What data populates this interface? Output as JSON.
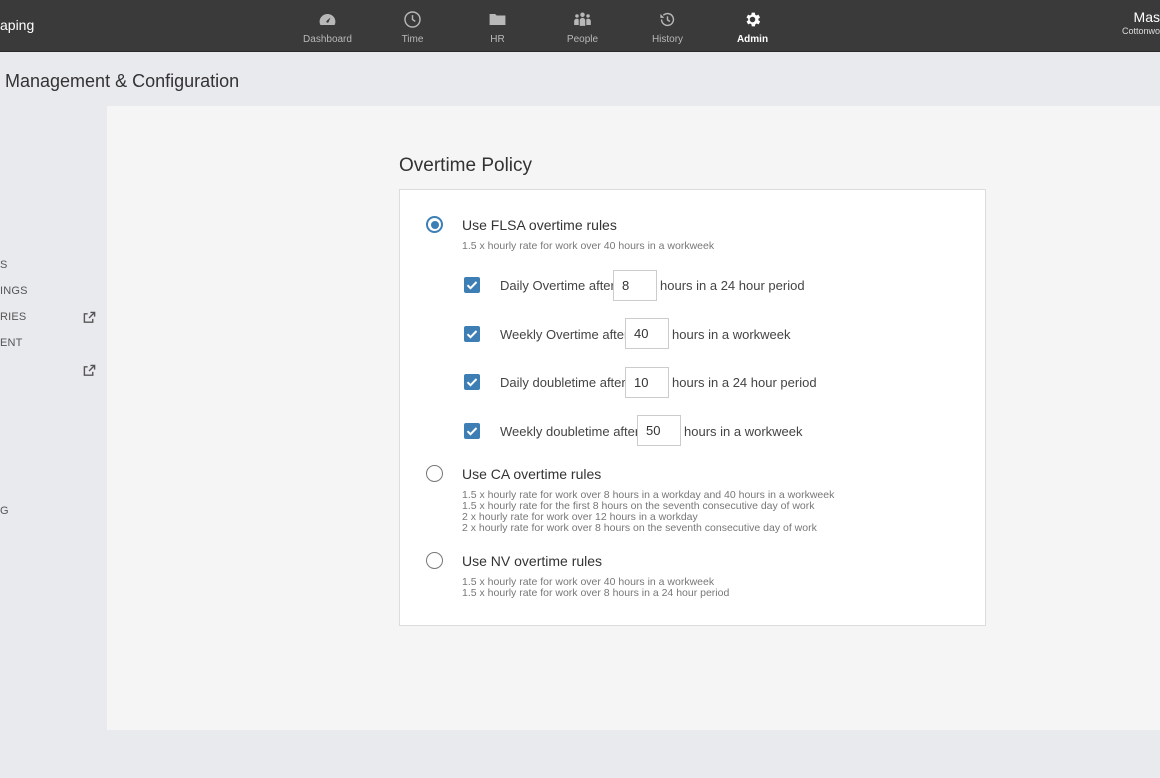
{
  "header": {
    "brand": "aping",
    "nav": [
      {
        "label": "Dashboard",
        "icon": "dashboard-icon"
      },
      {
        "label": "Time",
        "icon": "clock-icon"
      },
      {
        "label": "HR",
        "icon": "folder-icon"
      },
      {
        "label": "People",
        "icon": "people-icon"
      },
      {
        "label": "History",
        "icon": "history-icon"
      },
      {
        "label": "Admin",
        "icon": "gear-icon",
        "active": true
      }
    ],
    "user_name": "Mas",
    "user_org": "Cottonwo"
  },
  "page_title": "Management & Configuration",
  "sidebar": {
    "items": [
      {
        "label": "S"
      },
      {
        "label": "INGS"
      },
      {
        "label": "RIES",
        "external_icon": "external-link-icon"
      },
      {
        "label": "ENT"
      },
      {
        "label": "",
        "external_icon": "external-link-icon"
      },
      {
        "label": "G"
      }
    ]
  },
  "overtime": {
    "title": "Overtime Policy",
    "options": [
      {
        "title": "Use FLSA overtime rules",
        "selected": true,
        "description": [
          "1.5 x hourly rate for work over 40 hours in a workweek"
        ],
        "rules": [
          {
            "checked": true,
            "before": "Daily Overtime after",
            "value": "8",
            "after": "hours in a 24 hour period"
          },
          {
            "checked": true,
            "before": "Weekly Overtime after",
            "value": "40",
            "after": "hours in a workweek"
          },
          {
            "checked": true,
            "before": "Daily doubletime after",
            "value": "10",
            "after": "hours in a 24 hour period"
          },
          {
            "checked": true,
            "before": "Weekly doubletime after",
            "value": "50",
            "after": "hours in a workweek"
          }
        ]
      },
      {
        "title": "Use CA overtime rules",
        "selected": false,
        "description": [
          "1.5 x hourly rate for work over 8 hours in a workday and 40 hours in a workweek",
          "1.5 x hourly rate for the first 8 hours on the seventh consecutive day of work",
          "2 x hourly rate for work over 12 hours in a workday",
          "2 x hourly rate for work over 8 hours on the seventh consecutive day of work"
        ]
      },
      {
        "title": "Use NV overtime rules",
        "selected": false,
        "description": [
          "1.5 x hourly rate for work over 40 hours in a workweek",
          "1.5 x hourly rate for work over 8 hours in a 24 hour period"
        ]
      }
    ]
  },
  "colors": {
    "accent": "#3d7fb5",
    "topbar": "#3a3a3a",
    "background": "#e9eaee"
  }
}
